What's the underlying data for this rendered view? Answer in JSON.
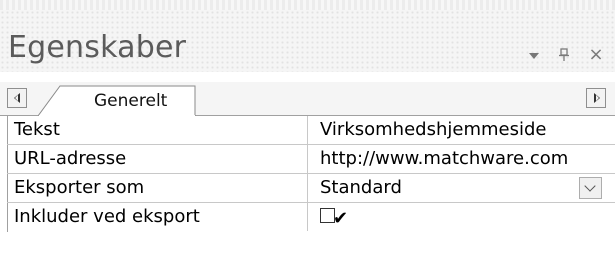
{
  "panel": {
    "title": "Egenskaber",
    "buttons": {
      "dropdown_icon": "chevron-down-icon",
      "pin_icon": "pin-icon",
      "close_label": "×"
    }
  },
  "tabs": {
    "nav_left_icon": "scroll-left-icon",
    "nav_right_icon": "scroll-right-icon",
    "active": "Generelt"
  },
  "properties": [
    {
      "name": "Tekst",
      "value": "Virksomhedshjemmeside",
      "kind": "text"
    },
    {
      "name": "URL-adresse",
      "value": "http://www.matchware.com",
      "kind": "text"
    },
    {
      "name": "Eksporter som",
      "value": "Standard",
      "kind": "combo"
    },
    {
      "name": "Inkluder ved eksport",
      "checked": true,
      "kind": "checkbox"
    }
  ],
  "colors": {
    "title": "#5b5b5b",
    "grid_line": "#c8c8c8",
    "background": "#ffffff"
  }
}
